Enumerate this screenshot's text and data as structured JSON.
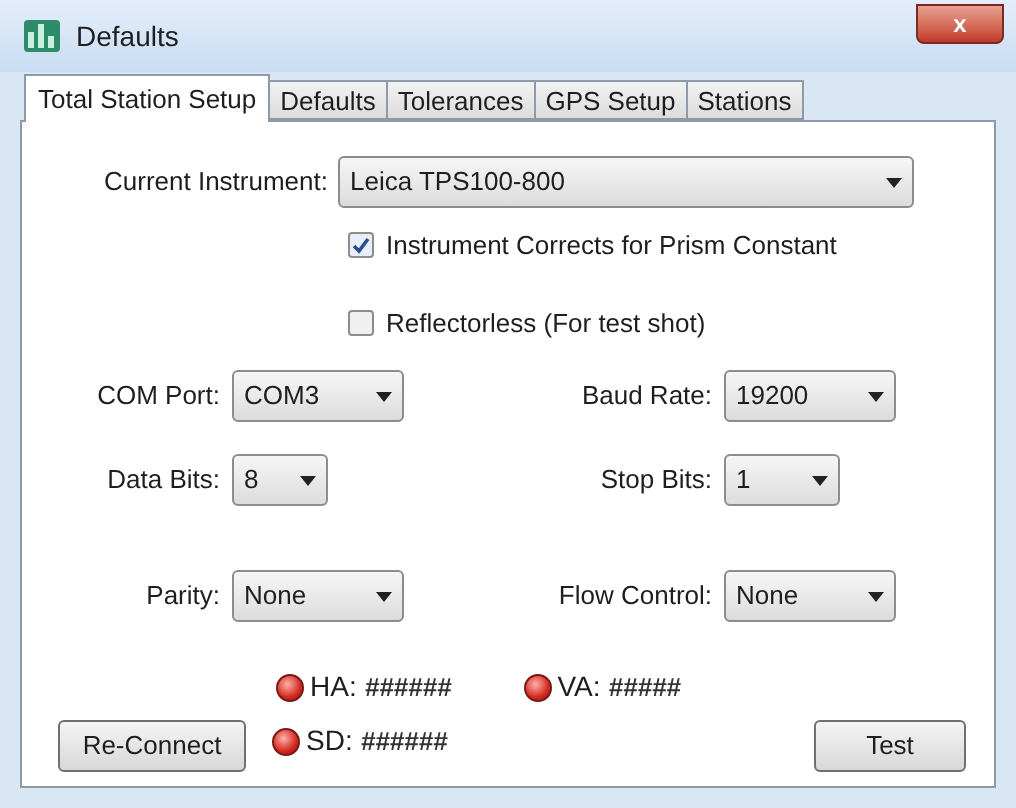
{
  "window": {
    "title": "Defaults",
    "close_label": "x"
  },
  "tabs": [
    {
      "label": "Total Station Setup",
      "selected": true
    },
    {
      "label": "Defaults",
      "selected": false
    },
    {
      "label": "Tolerances",
      "selected": false
    },
    {
      "label": "GPS Setup",
      "selected": false
    },
    {
      "label": "Stations",
      "selected": false
    }
  ],
  "instrument": {
    "label": "Current Instrument:",
    "value": "Leica TPS100-800"
  },
  "checkboxes": [
    {
      "label": "Instrument Corrects for Prism Constant",
      "checked": true
    },
    {
      "label": "Reflectorless (For test shot)",
      "checked": false
    }
  ],
  "settings": [
    {
      "label": "COM Port:",
      "value": "COM3"
    },
    {
      "label": "Baud Rate:",
      "value": "19200"
    },
    {
      "label": "Data Bits:",
      "value": "8"
    },
    {
      "label": "Stop Bits:",
      "value": "1"
    },
    {
      "label": "Parity:",
      "value": "None"
    },
    {
      "label": "Flow Control:",
      "value": "None"
    }
  ],
  "readings": [
    {
      "label": "HA:",
      "value": "######"
    },
    {
      "label": "VA:",
      "value": "#####"
    },
    {
      "label": "SD:",
      "value": "######"
    }
  ],
  "buttons": [
    {
      "label": "Re-Connect"
    },
    {
      "label": "Test"
    }
  ]
}
